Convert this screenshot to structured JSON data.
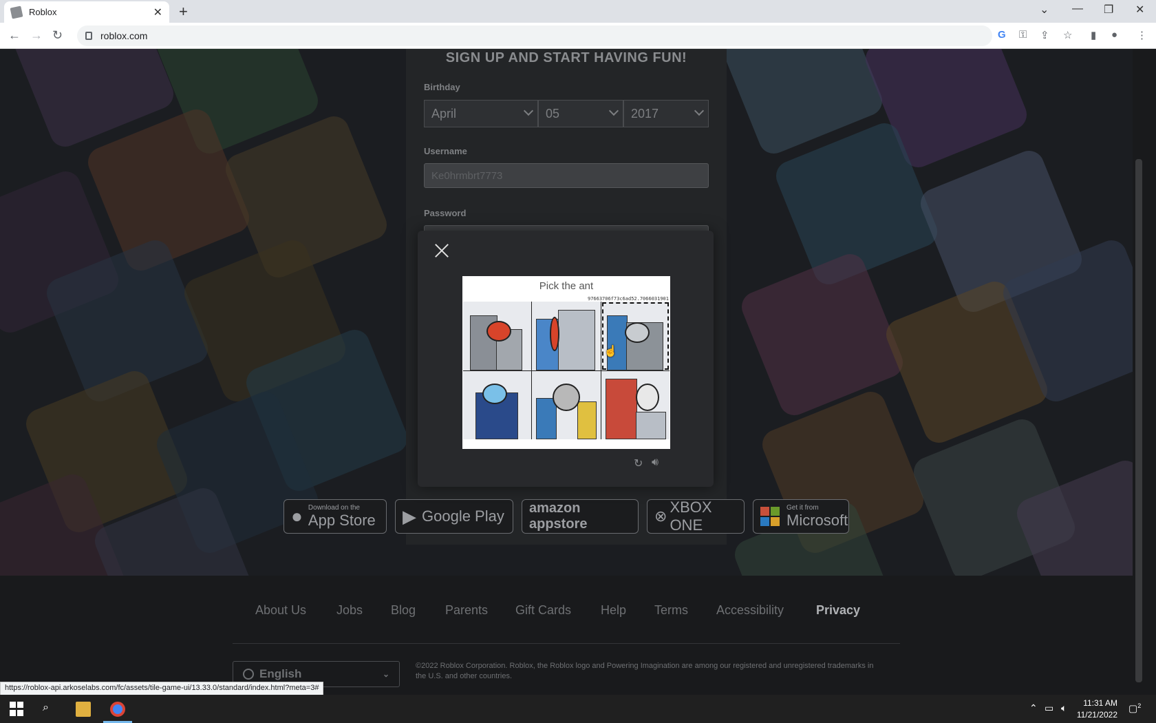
{
  "browser": {
    "tab_title": "Roblox",
    "new_tab": "+",
    "tab_close": "✕",
    "url": "roblox.com"
  },
  "signup": {
    "title": "SIGN UP AND START HAVING FUN!",
    "birthday_label": "Birthday",
    "month": "April",
    "day": "05",
    "year": "2017",
    "username_label": "Username",
    "username_value": "Ke0hrmbrt7773",
    "password_label": "Password"
  },
  "captcha": {
    "prompt": "Pick the ant",
    "hash": "97663706f73c6ad52.7066031901",
    "tiles": [
      "spider",
      "ant",
      "bat",
      "dolphin",
      "elephant",
      "koala"
    ],
    "selected_index": 2
  },
  "stores": {
    "appstore_small": "Download on the",
    "appstore": "App Store",
    "googleplay": "Google Play",
    "amazon": "amazon appstore",
    "xbox": "XBOX ONE",
    "microsoft_small": "Get it from",
    "microsoft": "Microsoft"
  },
  "footer": {
    "links": [
      "About Us",
      "Jobs",
      "Blog",
      "Parents",
      "Gift Cards",
      "Help",
      "Terms",
      "Accessibility",
      "Privacy"
    ],
    "language": "English",
    "copyright": "©2022 Roblox Corporation. Roblox, the Roblox logo and Powering Imagination are among our registered and unregistered trademarks in the U.S. and other countries."
  },
  "status_url": "https://roblox-api.arkoselabs.com/fc/assets/tile-game-ui/13.33.0/standard/index.html?meta=3#",
  "taskbar": {
    "time": "11:31 AM",
    "date": "11/21/2022",
    "notifications": "2"
  },
  "colors": {
    "accent": "#232527",
    "modal": "#28292c",
    "footer": "#191a1c"
  }
}
